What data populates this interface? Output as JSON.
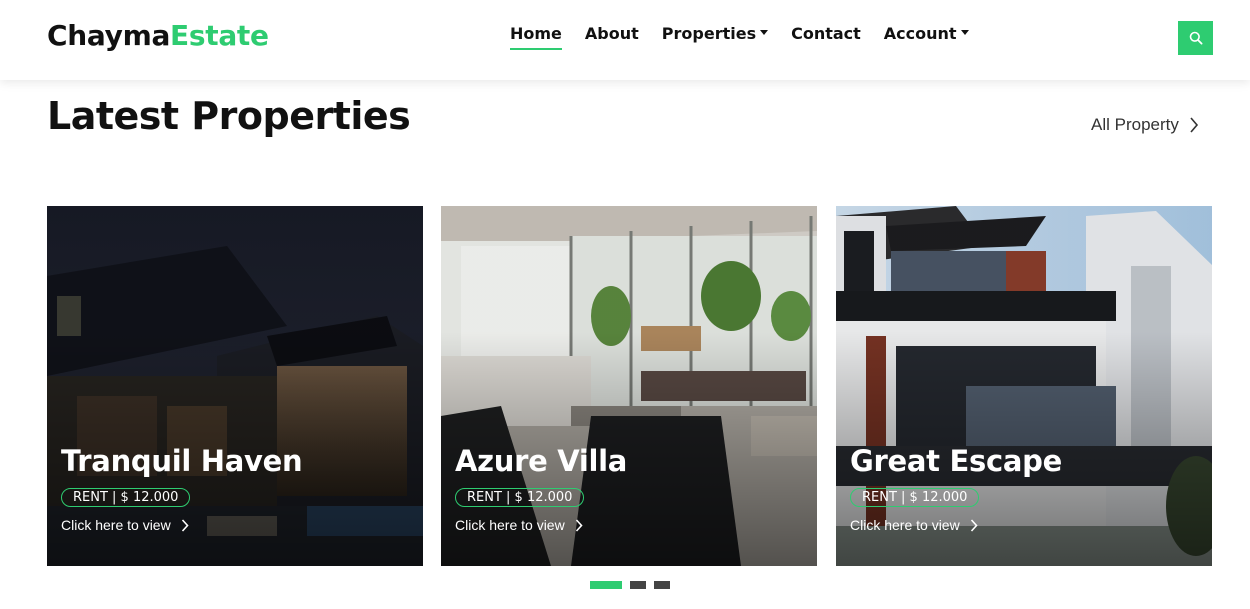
{
  "brand": {
    "part1": "Chayma",
    "part2": "Estate"
  },
  "nav": [
    {
      "label": "Home",
      "active": true,
      "dropdown": false
    },
    {
      "label": "About",
      "active": false,
      "dropdown": false
    },
    {
      "label": "Properties",
      "active": false,
      "dropdown": true
    },
    {
      "label": "Contact",
      "active": false,
      "dropdown": false
    },
    {
      "label": "Account",
      "active": false,
      "dropdown": true
    }
  ],
  "search": {
    "icon": "search-icon"
  },
  "section": {
    "title": "Latest Properties",
    "all_link": "All Property"
  },
  "cards": [
    {
      "title": "Tranquil Haven",
      "price": "RENT | $ 12.000",
      "cta": "Click here to view"
    },
    {
      "title": "Azure Villa",
      "price": "RENT | $ 12.000",
      "cta": "Click here to view"
    },
    {
      "title": "Great Escape",
      "price": "RENT | $ 12.000",
      "cta": "Click here to view"
    }
  ],
  "pagination": {
    "count": 3,
    "active_index": 0
  },
  "colors": {
    "accent": "#2ecc71",
    "text": "#111111"
  }
}
